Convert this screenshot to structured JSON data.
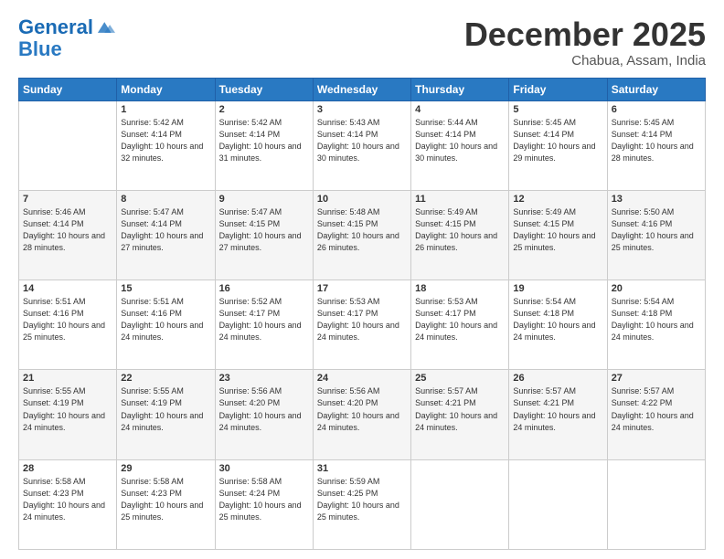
{
  "header": {
    "logo_line1": "General",
    "logo_line2": "Blue",
    "month": "December 2025",
    "location": "Chabua, Assam, India"
  },
  "weekdays": [
    "Sunday",
    "Monday",
    "Tuesday",
    "Wednesday",
    "Thursday",
    "Friday",
    "Saturday"
  ],
  "weeks": [
    [
      {
        "day": "",
        "sunrise": "",
        "sunset": "",
        "daylight": ""
      },
      {
        "day": "1",
        "sunrise": "Sunrise: 5:42 AM",
        "sunset": "Sunset: 4:14 PM",
        "daylight": "Daylight: 10 hours and 32 minutes."
      },
      {
        "day": "2",
        "sunrise": "Sunrise: 5:42 AM",
        "sunset": "Sunset: 4:14 PM",
        "daylight": "Daylight: 10 hours and 31 minutes."
      },
      {
        "day": "3",
        "sunrise": "Sunrise: 5:43 AM",
        "sunset": "Sunset: 4:14 PM",
        "daylight": "Daylight: 10 hours and 30 minutes."
      },
      {
        "day": "4",
        "sunrise": "Sunrise: 5:44 AM",
        "sunset": "Sunset: 4:14 PM",
        "daylight": "Daylight: 10 hours and 30 minutes."
      },
      {
        "day": "5",
        "sunrise": "Sunrise: 5:45 AM",
        "sunset": "Sunset: 4:14 PM",
        "daylight": "Daylight: 10 hours and 29 minutes."
      },
      {
        "day": "6",
        "sunrise": "Sunrise: 5:45 AM",
        "sunset": "Sunset: 4:14 PM",
        "daylight": "Daylight: 10 hours and 28 minutes."
      }
    ],
    [
      {
        "day": "7",
        "sunrise": "Sunrise: 5:46 AM",
        "sunset": "Sunset: 4:14 PM",
        "daylight": "Daylight: 10 hours and 28 minutes."
      },
      {
        "day": "8",
        "sunrise": "Sunrise: 5:47 AM",
        "sunset": "Sunset: 4:14 PM",
        "daylight": "Daylight: 10 hours and 27 minutes."
      },
      {
        "day": "9",
        "sunrise": "Sunrise: 5:47 AM",
        "sunset": "Sunset: 4:15 PM",
        "daylight": "Daylight: 10 hours and 27 minutes."
      },
      {
        "day": "10",
        "sunrise": "Sunrise: 5:48 AM",
        "sunset": "Sunset: 4:15 PM",
        "daylight": "Daylight: 10 hours and 26 minutes."
      },
      {
        "day": "11",
        "sunrise": "Sunrise: 5:49 AM",
        "sunset": "Sunset: 4:15 PM",
        "daylight": "Daylight: 10 hours and 26 minutes."
      },
      {
        "day": "12",
        "sunrise": "Sunrise: 5:49 AM",
        "sunset": "Sunset: 4:15 PM",
        "daylight": "Daylight: 10 hours and 25 minutes."
      },
      {
        "day": "13",
        "sunrise": "Sunrise: 5:50 AM",
        "sunset": "Sunset: 4:16 PM",
        "daylight": "Daylight: 10 hours and 25 minutes."
      }
    ],
    [
      {
        "day": "14",
        "sunrise": "Sunrise: 5:51 AM",
        "sunset": "Sunset: 4:16 PM",
        "daylight": "Daylight: 10 hours and 25 minutes."
      },
      {
        "day": "15",
        "sunrise": "Sunrise: 5:51 AM",
        "sunset": "Sunset: 4:16 PM",
        "daylight": "Daylight: 10 hours and 24 minutes."
      },
      {
        "day": "16",
        "sunrise": "Sunrise: 5:52 AM",
        "sunset": "Sunset: 4:17 PM",
        "daylight": "Daylight: 10 hours and 24 minutes."
      },
      {
        "day": "17",
        "sunrise": "Sunrise: 5:53 AM",
        "sunset": "Sunset: 4:17 PM",
        "daylight": "Daylight: 10 hours and 24 minutes."
      },
      {
        "day": "18",
        "sunrise": "Sunrise: 5:53 AM",
        "sunset": "Sunset: 4:17 PM",
        "daylight": "Daylight: 10 hours and 24 minutes."
      },
      {
        "day": "19",
        "sunrise": "Sunrise: 5:54 AM",
        "sunset": "Sunset: 4:18 PM",
        "daylight": "Daylight: 10 hours and 24 minutes."
      },
      {
        "day": "20",
        "sunrise": "Sunrise: 5:54 AM",
        "sunset": "Sunset: 4:18 PM",
        "daylight": "Daylight: 10 hours and 24 minutes."
      }
    ],
    [
      {
        "day": "21",
        "sunrise": "Sunrise: 5:55 AM",
        "sunset": "Sunset: 4:19 PM",
        "daylight": "Daylight: 10 hours and 24 minutes."
      },
      {
        "day": "22",
        "sunrise": "Sunrise: 5:55 AM",
        "sunset": "Sunset: 4:19 PM",
        "daylight": "Daylight: 10 hours and 24 minutes."
      },
      {
        "day": "23",
        "sunrise": "Sunrise: 5:56 AM",
        "sunset": "Sunset: 4:20 PM",
        "daylight": "Daylight: 10 hours and 24 minutes."
      },
      {
        "day": "24",
        "sunrise": "Sunrise: 5:56 AM",
        "sunset": "Sunset: 4:20 PM",
        "daylight": "Daylight: 10 hours and 24 minutes."
      },
      {
        "day": "25",
        "sunrise": "Sunrise: 5:57 AM",
        "sunset": "Sunset: 4:21 PM",
        "daylight": "Daylight: 10 hours and 24 minutes."
      },
      {
        "day": "26",
        "sunrise": "Sunrise: 5:57 AM",
        "sunset": "Sunset: 4:21 PM",
        "daylight": "Daylight: 10 hours and 24 minutes."
      },
      {
        "day": "27",
        "sunrise": "Sunrise: 5:57 AM",
        "sunset": "Sunset: 4:22 PM",
        "daylight": "Daylight: 10 hours and 24 minutes."
      }
    ],
    [
      {
        "day": "28",
        "sunrise": "Sunrise: 5:58 AM",
        "sunset": "Sunset: 4:23 PM",
        "daylight": "Daylight: 10 hours and 24 minutes."
      },
      {
        "day": "29",
        "sunrise": "Sunrise: 5:58 AM",
        "sunset": "Sunset: 4:23 PM",
        "daylight": "Daylight: 10 hours and 25 minutes."
      },
      {
        "day": "30",
        "sunrise": "Sunrise: 5:58 AM",
        "sunset": "Sunset: 4:24 PM",
        "daylight": "Daylight: 10 hours and 25 minutes."
      },
      {
        "day": "31",
        "sunrise": "Sunrise: 5:59 AM",
        "sunset": "Sunset: 4:25 PM",
        "daylight": "Daylight: 10 hours and 25 minutes."
      },
      {
        "day": "",
        "sunrise": "",
        "sunset": "",
        "daylight": ""
      },
      {
        "day": "",
        "sunrise": "",
        "sunset": "",
        "daylight": ""
      },
      {
        "day": "",
        "sunrise": "",
        "sunset": "",
        "daylight": ""
      }
    ]
  ]
}
